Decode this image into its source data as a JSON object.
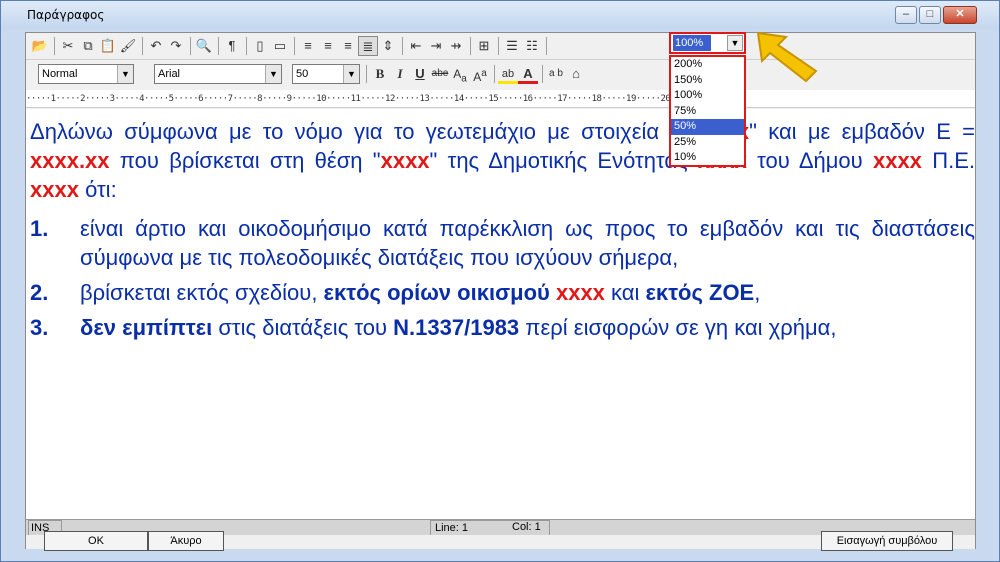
{
  "window": {
    "title": "Παράγραφος",
    "minimize": "–",
    "maximize": "□",
    "close": "✕"
  },
  "toolbar": {
    "style_value": "Normal",
    "font_value": "Arial",
    "size_value": "50",
    "zoom_value": "100%",
    "zoom_options": [
      "200%",
      "150%",
      "100%",
      "75%",
      "50%",
      "25%",
      "10%"
    ],
    "zoom_selected": "50%",
    "bold": "B",
    "italic": "I",
    "underline": "U",
    "strike": "abe",
    "sub": "A",
    "sub_a": "a",
    "sup": "A",
    "sup_a": "a",
    "highlight": "ab",
    "fontcolor": "A",
    "spell": "a b"
  },
  "ruler": "·····1·····2·····3·····4·····5·····6·····7·····8·····9·····10·····11·····12·····13·····14·····15·····16·····17·····18·····19·····20·····21·····22",
  "document": {
    "p1_a": "Δηλώνω σύμφωνα με το νόμο για το γεωτεμάχιο με στοιχεία \"",
    "p1_code": "x-x-x-x",
    "p1_b": "\" και με εμβαδόν Ε = ",
    "p1_area": "xxxx.xx",
    "p1_c": " που βρίσκεται στη θέση \"",
    "p1_place": "xxxx",
    "p1_d": "\" της Δημοτικής Ενότητας ",
    "p1_unit": "xxxx",
    "p1_e": " του Δήμου ",
    "p1_municipality": "xxxx",
    "p1_f": "  Π.Ε. ",
    "p1_pe": "xxxx",
    "p1_g": " ότι:",
    "items": [
      {
        "num": "1.",
        "text": "είναι άρτιο και οικοδομήσιμο κατά παρέκκλιση ως προς το εμβαδόν και τις διαστάσεις σύμφωνα με τις πολεοδομικές διατάξεις που ισχύουν σήμερα,"
      },
      {
        "num": "2.",
        "a": "βρίσκεται εκτός σχεδίου, ",
        "b": "εκτός ορίων οικισμού",
        "c": " ",
        "red": "xxxx",
        "d": " και ",
        "e": "εκτός ΖΟΕ",
        "f": ","
      },
      {
        "num": "3.",
        "a": "δεν εμπίπτει",
        "b": " στις διατάξεις του ",
        "c": "Ν.1337/1983",
        "d": " περί εισφορών σε γη και χρήμα,"
      }
    ]
  },
  "status": {
    "mode": "INS",
    "line": "Line: 1",
    "col": "Col: 1"
  },
  "buttons": {
    "ok": "OK",
    "cancel": "Άκυρο",
    "insert_symbol": "Εισαγωγή συμβόλου"
  },
  "colors": {
    "text": "#0a2ea8",
    "highlight_red": "#e01818",
    "selection": "#3b5fcf",
    "pointer": "#f5c200"
  }
}
